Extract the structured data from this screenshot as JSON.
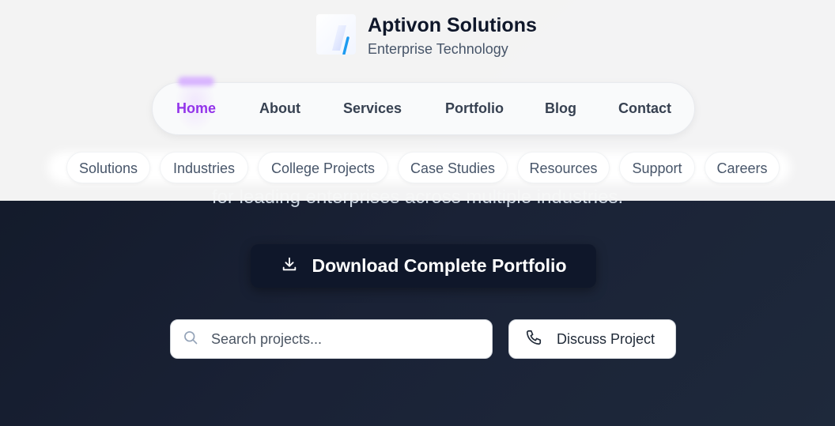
{
  "brand": {
    "name": "Aptivon Solutions",
    "tagline": "Enterprise Technology",
    "logo_icon": "slash-stroke-logo",
    "accent_color": "#1d9bf0"
  },
  "main_nav": {
    "items": [
      {
        "label": "Home",
        "active": true
      },
      {
        "label": "About"
      },
      {
        "label": "Services"
      },
      {
        "label": "Portfolio"
      },
      {
        "label": "Blog"
      },
      {
        "label": "Contact"
      }
    ],
    "active_color": "#9333ea"
  },
  "sub_nav": {
    "items": [
      {
        "label": "Solutions"
      },
      {
        "label": "Industries"
      },
      {
        "label": "College Projects"
      },
      {
        "label": "Case Studies"
      },
      {
        "label": "Resources"
      },
      {
        "label": "Support"
      },
      {
        "label": "Careers"
      }
    ]
  },
  "hero": {
    "subtitle": "for leading enterprises across multiple industries.",
    "download_button": {
      "label": "Download Complete Portfolio",
      "icon": "download-icon"
    },
    "search": {
      "placeholder": "Search projects...",
      "value": "",
      "icon": "search-icon"
    },
    "discuss_button": {
      "label": "Discuss Project",
      "icon": "phone-icon"
    }
  }
}
